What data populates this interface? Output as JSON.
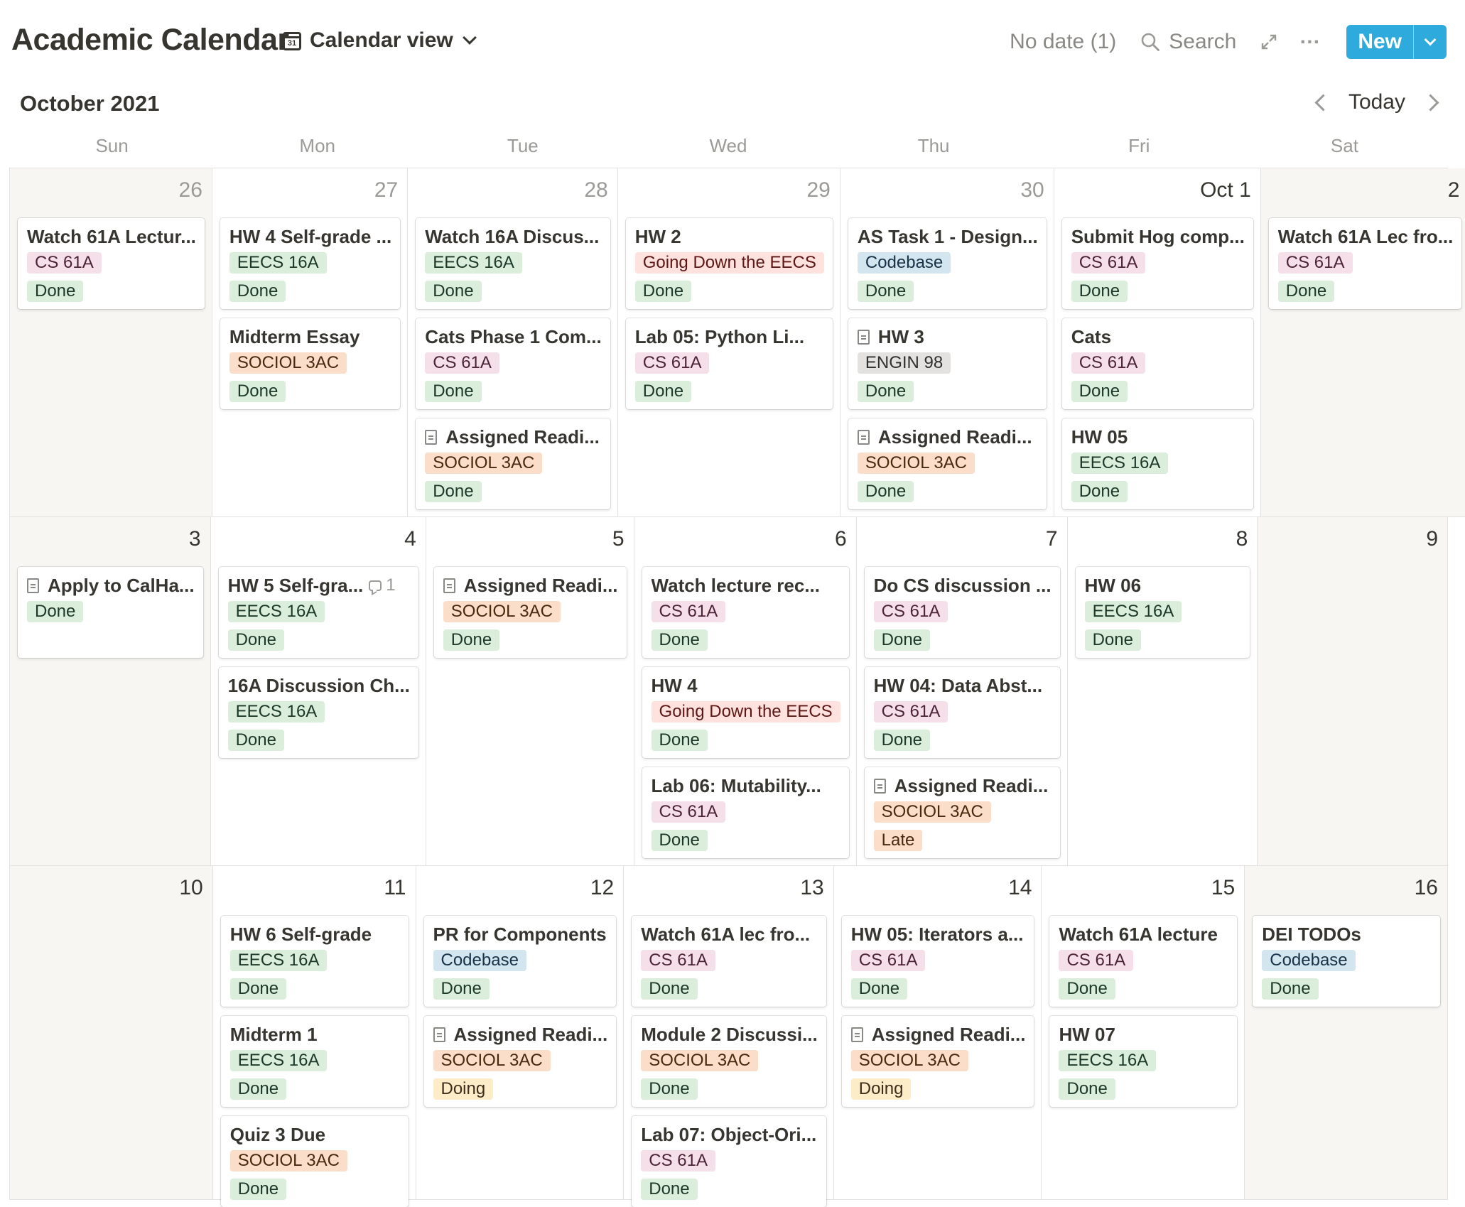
{
  "header": {
    "title": "Academic Calendar",
    "view_label": "Calendar view",
    "view_icon_text": "31",
    "no_date": "No date (1)",
    "search": "Search",
    "new_label": "New"
  },
  "nav": {
    "month": "October 2021",
    "today": "Today"
  },
  "weekdays": [
    "Sun",
    "Mon",
    "Tue",
    "Wed",
    "Thu",
    "Fri",
    "Sat"
  ],
  "colors": {
    "accent": "#2eaadc",
    "CS 61A": "#f5e0e9",
    "EECS 16A": "#dbeddb",
    "SOCIOL 3AC": "#fadec9",
    "Codebase": "#d3e5ef",
    "ENGIN 98": "#e3e2e0",
    "Going Down the EECS": "#ffe2dd",
    "Done": "#dbeddb",
    "Late": "#fadec9",
    "Doing": "#fdecc8"
  },
  "weeks": [
    {
      "days": [
        {
          "num": "26",
          "current": false,
          "events": [
            {
              "title": "Watch 61A Lectur...",
              "tag": "CS 61A",
              "status": "Done"
            }
          ]
        },
        {
          "num": "27",
          "current": false,
          "events": [
            {
              "title": "HW 4 Self-grade ...",
              "tag": "EECS 16A",
              "status": "Done"
            },
            {
              "title": "Midterm Essay",
              "tag": "SOCIOL 3AC",
              "status": "Done"
            }
          ]
        },
        {
          "num": "28",
          "current": false,
          "events": [
            {
              "title": "Watch 16A Discus...",
              "tag": "EECS 16A",
              "status": "Done"
            },
            {
              "title": "Cats Phase 1 Com...",
              "tag": "CS 61A",
              "status": "Done"
            },
            {
              "title": "Assigned Readi...",
              "doc": true,
              "tag": "SOCIOL 3AC",
              "status": "Done"
            }
          ]
        },
        {
          "num": "29",
          "current": false,
          "events": [
            {
              "title": "HW 2",
              "tag": "Going Down the EECS",
              "status": "Done"
            },
            {
              "title": "Lab 05: Python Li...",
              "tag": "CS 61A",
              "status": "Done"
            }
          ]
        },
        {
          "num": "30",
          "current": false,
          "events": [
            {
              "title": "AS Task 1 - Design...",
              "tag": "Codebase",
              "status": "Done"
            },
            {
              "title": "HW 3",
              "doc": true,
              "tag": "ENGIN 98",
              "status": "Done"
            },
            {
              "title": "Assigned Readi...",
              "doc": true,
              "tag": "SOCIOL 3AC",
              "status": "Done"
            }
          ]
        },
        {
          "num": "Oct 1",
          "current": true,
          "events": [
            {
              "title": "Submit Hog comp...",
              "tag": "CS 61A",
              "status": "Done"
            },
            {
              "title": "Cats",
              "tag": "CS 61A",
              "status": "Done"
            },
            {
              "title": "HW 05",
              "tag": "EECS 16A",
              "status": "Done"
            }
          ]
        },
        {
          "num": "2",
          "current": true,
          "events": [
            {
              "title": "Watch 61A Lec fro...",
              "tag": "CS 61A",
              "status": "Done"
            }
          ]
        }
      ]
    },
    {
      "days": [
        {
          "num": "3",
          "current": true,
          "events": [
            {
              "title": "Apply to CalHa...",
              "doc": true,
              "status": "Done"
            }
          ]
        },
        {
          "num": "4",
          "current": true,
          "events": [
            {
              "title": "HW 5 Self-gra...",
              "comments": "1",
              "tag": "EECS 16A",
              "status": "Done"
            },
            {
              "title": "16A Discussion Ch...",
              "tag": "EECS 16A",
              "status": "Done"
            }
          ]
        },
        {
          "num": "5",
          "current": true,
          "events": [
            {
              "title": "Assigned Readi...",
              "doc": true,
              "tag": "SOCIOL 3AC",
              "status": "Done"
            }
          ]
        },
        {
          "num": "6",
          "current": true,
          "events": [
            {
              "title": "Watch lecture rec...",
              "tag": "CS 61A",
              "status": "Done"
            },
            {
              "title": "HW 4",
              "tag": "Going Down the EECS",
              "status": "Done"
            },
            {
              "title": "Lab 06: Mutability...",
              "tag": "CS 61A",
              "status": "Done"
            }
          ]
        },
        {
          "num": "7",
          "current": true,
          "events": [
            {
              "title": "Do CS discussion ...",
              "tag": "CS 61A",
              "status": "Done"
            },
            {
              "title": "HW 04: Data Abst...",
              "tag": "CS 61A",
              "status": "Done"
            },
            {
              "title": "Assigned Readi...",
              "doc": true,
              "tag": "SOCIOL 3AC",
              "status": "Late"
            }
          ]
        },
        {
          "num": "8",
          "current": true,
          "events": [
            {
              "title": "HW 06",
              "tag": "EECS 16A",
              "status": "Done"
            }
          ]
        },
        {
          "num": "9",
          "current": true,
          "events": []
        }
      ]
    },
    {
      "days": [
        {
          "num": "10",
          "current": true,
          "events": []
        },
        {
          "num": "11",
          "current": true,
          "events": [
            {
              "title": "HW 6 Self-grade",
              "tag": "EECS 16A",
              "status": "Done"
            },
            {
              "title": "Midterm 1",
              "tag": "EECS 16A",
              "status": "Done"
            },
            {
              "title": "Quiz 3 Due",
              "tag": "SOCIOL 3AC",
              "status": "Done"
            }
          ]
        },
        {
          "num": "12",
          "current": true,
          "events": [
            {
              "title": "PR for Components",
              "tag": "Codebase",
              "status": "Done"
            },
            {
              "title": "Assigned Readi...",
              "doc": true,
              "tag": "SOCIOL 3AC",
              "status": "Doing"
            }
          ]
        },
        {
          "num": "13",
          "current": true,
          "events": [
            {
              "title": "Watch 61A lec fro...",
              "tag": "CS 61A",
              "status": "Done"
            },
            {
              "title": "Module 2 Discussi...",
              "tag": "SOCIOL 3AC",
              "status": "Done"
            },
            {
              "title": "Lab 07: Object-Ori...",
              "tag": "CS 61A",
              "status": "Done"
            }
          ]
        },
        {
          "num": "14",
          "current": true,
          "events": [
            {
              "title": "HW 05: Iterators a...",
              "tag": "CS 61A",
              "status": "Done"
            },
            {
              "title": "Assigned Readi...",
              "doc": true,
              "tag": "SOCIOL 3AC",
              "status": "Doing"
            }
          ]
        },
        {
          "num": "15",
          "current": true,
          "events": [
            {
              "title": "Watch 61A lecture",
              "tag": "CS 61A",
              "status": "Done"
            },
            {
              "title": "HW 07",
              "tag": "EECS 16A",
              "status": "Done"
            }
          ]
        },
        {
          "num": "16",
          "current": true,
          "events": [
            {
              "title": "DEI TODOs",
              "tag": "Codebase",
              "status": "Done"
            }
          ]
        }
      ]
    }
  ]
}
